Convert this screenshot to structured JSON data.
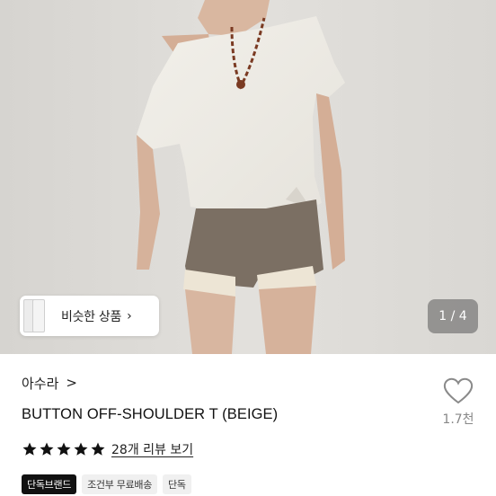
{
  "gallery": {
    "similar_label": "비슷한 상품",
    "similar_chevron": "›",
    "counter": "1 / 4"
  },
  "product": {
    "brand": "아수라",
    "brand_chevron": ">",
    "title": "BUTTON OFF-SHOULDER T (BEIGE)",
    "rating_stars": 5,
    "review_text": "28개 리뷰 보기",
    "like_count": "1.7천"
  },
  "tags": [
    "단독브랜드",
    "조건부 무료배송",
    "단독"
  ],
  "colors": {
    "star": "#111111",
    "tag_dark_bg": "#111111",
    "tag_bg": "#f0f0f0",
    "like_count": "#888888"
  },
  "icons": [
    "heart-outline-icon",
    "star-icon",
    "chevron-right-icon"
  ]
}
